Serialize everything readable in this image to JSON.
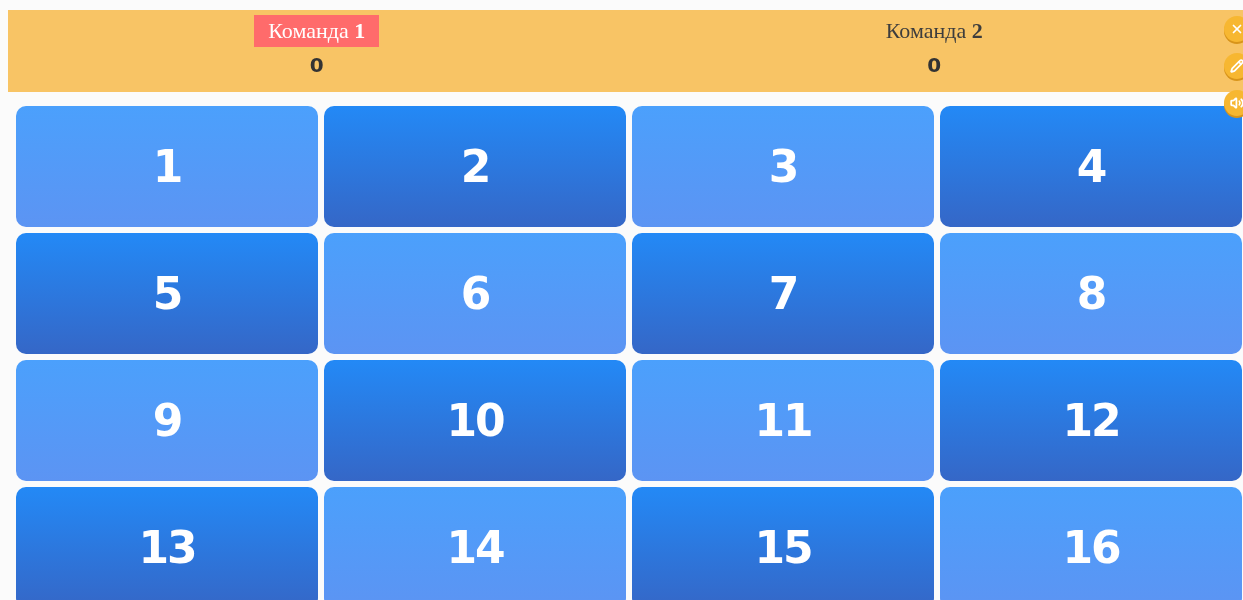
{
  "teams": [
    {
      "name": "Команда **1**",
      "score": "0",
      "selected": true
    },
    {
      "name": "Команда **2**",
      "score": "0",
      "selected": false
    }
  ],
  "side_buttons": [
    {
      "kind": "close"
    },
    {
      "kind": "edit"
    },
    {
      "kind": "sound"
    }
  ],
  "tiles": [
    {
      "label": "1",
      "kind": "light"
    },
    {
      "label": "2",
      "kind": "dark"
    },
    {
      "label": "3",
      "kind": "light"
    },
    {
      "label": "4",
      "kind": "dark"
    },
    {
      "label": "5",
      "kind": "dark"
    },
    {
      "label": "6",
      "kind": "light"
    },
    {
      "label": "7",
      "kind": "dark"
    },
    {
      "label": "8",
      "kind": "light"
    },
    {
      "label": "9",
      "kind": "light"
    },
    {
      "label": "10",
      "kind": "dark"
    },
    {
      "label": "11",
      "kind": "light"
    },
    {
      "label": "12",
      "kind": "dark"
    },
    {
      "label": "13",
      "kind": "dark"
    },
    {
      "label": "14",
      "kind": "light"
    },
    {
      "label": "15",
      "kind": "dark"
    },
    {
      "label": "16",
      "kind": "light"
    }
  ]
}
